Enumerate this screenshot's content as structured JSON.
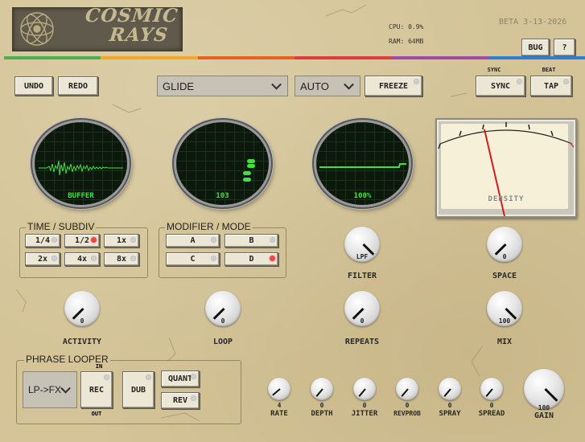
{
  "header": {
    "logo_line1": "COSMIC",
    "logo_line2": "RAYS",
    "cpu": "CPU: 0.9%",
    "ram": "RAM: 64MB",
    "version": "BETA 3-13-2026",
    "bug_label": "BUG",
    "help_label": "?"
  },
  "rainbow_colors": [
    "#4caf50",
    "#f6a623",
    "#e8631f",
    "#e23b3b",
    "#a24aa8",
    "#2a7fd4"
  ],
  "toolbar": {
    "undo": "UNDO",
    "redo": "REDO",
    "mode_select": "GLIDE",
    "auto_select": "AUTO",
    "freeze": "FREEZE",
    "sync_caption": "SYNC",
    "sync": "SYNC",
    "beat_caption": "BEAT",
    "tap": "TAP"
  },
  "scopes": {
    "buffer": "BUFFER",
    "pitch": "103",
    "level": "100%"
  },
  "meter": {
    "label": "DENSITY"
  },
  "time_subdiv": {
    "title": "TIME / SUBDIV",
    "buttons": [
      {
        "label": "1/4",
        "active": false
      },
      {
        "label": "1/2",
        "active": true
      },
      {
        "label": "1x",
        "active": false
      },
      {
        "label": "2x",
        "active": false
      },
      {
        "label": "4x",
        "active": false
      },
      {
        "label": "8x",
        "active": false
      }
    ]
  },
  "modifier": {
    "title": "MODIFIER / MODE",
    "buttons": [
      {
        "label": "A",
        "active": false
      },
      {
        "label": "B",
        "active": false
      },
      {
        "label": "C",
        "active": false
      },
      {
        "label": "D",
        "active": true
      }
    ]
  },
  "knobs": {
    "filter": {
      "label": "FILTER",
      "value": "LPF"
    },
    "space": {
      "label": "SPACE",
      "value": "0"
    },
    "activity": {
      "label": "ACTIVITY",
      "value": "0"
    },
    "loop": {
      "label": "LOOP",
      "value": "0"
    },
    "repeats": {
      "label": "REPEATS",
      "value": "0"
    },
    "mix": {
      "label": "MIX",
      "value": "100"
    }
  },
  "looper": {
    "title": "PHRASE LOOPER",
    "routing": "LP->FX",
    "in": "IN",
    "out": "OUT",
    "rec": "REC",
    "dub": "DUB",
    "quant": "QUANT",
    "rev": "REV"
  },
  "small_knobs": [
    {
      "label": "RATE",
      "value": "4"
    },
    {
      "label": "DEPTH",
      "value": "0"
    },
    {
      "label": "JITTER",
      "value": "0"
    },
    {
      "label": "REVPROB",
      "value": "0"
    },
    {
      "label": "SPRAY",
      "value": "0"
    },
    {
      "label": "SPREAD",
      "value": "0"
    }
  ],
  "gain": {
    "label": "GAIN",
    "value": "100"
  }
}
